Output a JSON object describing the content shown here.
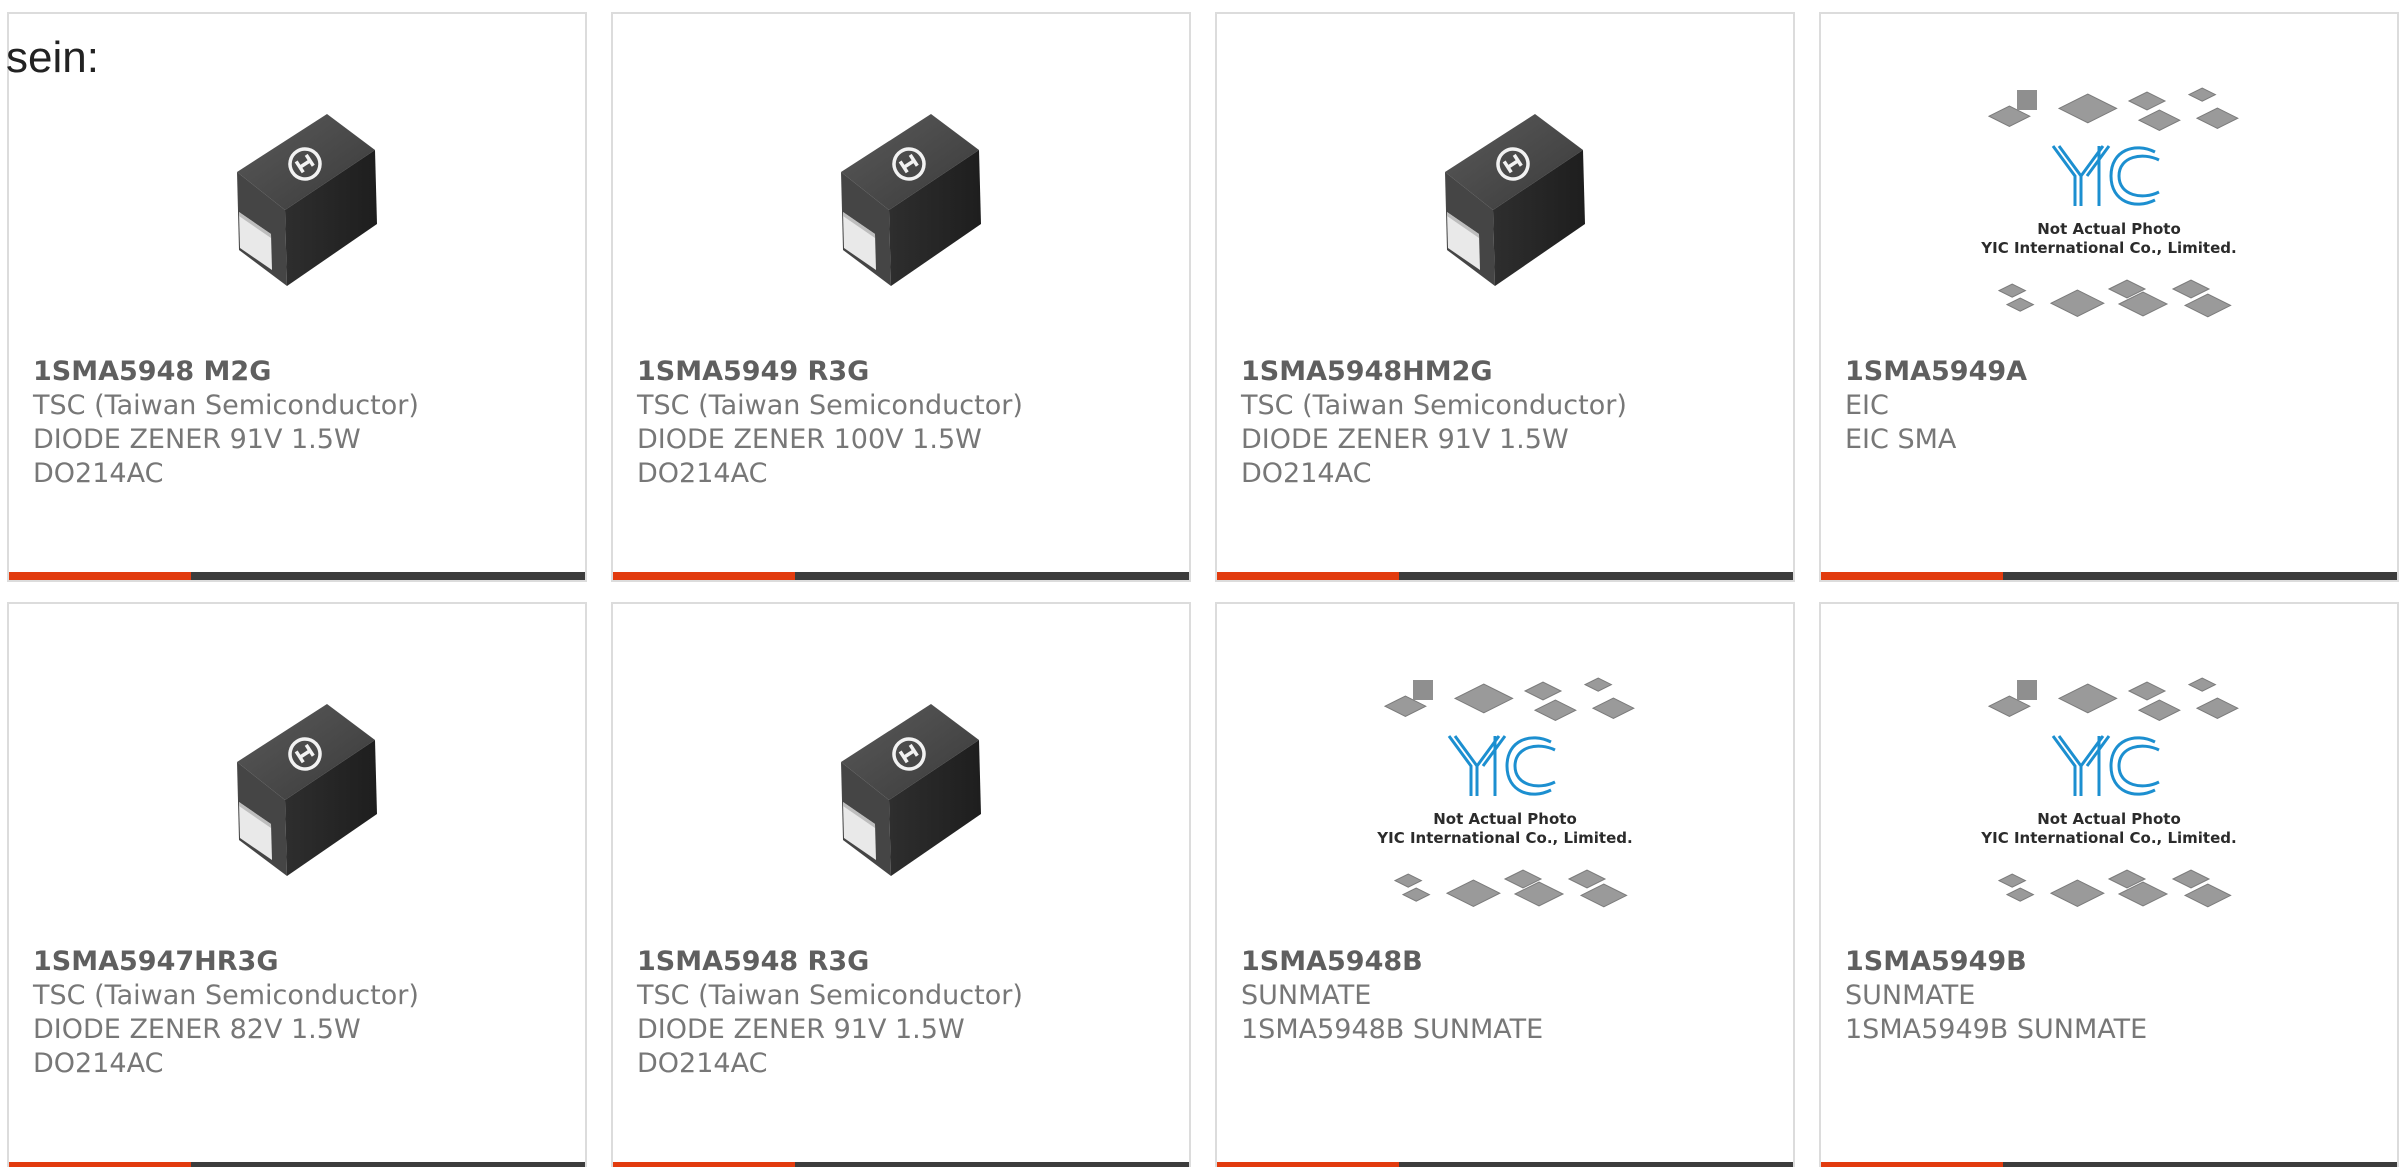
{
  "intro_text": "sein:",
  "colors": {
    "accent": "#e23b0e",
    "bar": "#3c3c3c",
    "card_border": "#dcdcdc",
    "text": "#777777",
    "yic_blue": "#1c8fd0"
  },
  "placeholder": {
    "line1": "Not Actual Photo",
    "line2": "YIC International Co., Limited."
  },
  "products": [
    {
      "part": "1SMA5948 M2G",
      "manufacturer": "TSC (Taiwan Semiconductor)",
      "description": "DIODE ZENER 91V 1.5W",
      "package": "DO214AC",
      "image": "sma-diode-icon"
    },
    {
      "part": "1SMA5949 R3G",
      "manufacturer": "TSC (Taiwan Semiconductor)",
      "description": "DIODE ZENER 100V 1.5W",
      "package": "DO214AC",
      "image": "sma-diode-icon"
    },
    {
      "part": "1SMA5948HM2G",
      "manufacturer": "TSC (Taiwan Semiconductor)",
      "description": "DIODE ZENER 91V 1.5W",
      "package": "DO214AC",
      "image": "sma-diode-icon"
    },
    {
      "part": "1SMA5949A",
      "manufacturer": "EIC",
      "description": "EIC SMA",
      "package": "",
      "image": "yic-placeholder"
    },
    {
      "part": "1SMA5947HR3G",
      "manufacturer": "TSC (Taiwan Semiconductor)",
      "description": "DIODE ZENER 82V 1.5W",
      "package": "DO214AC",
      "image": "sma-diode-icon"
    },
    {
      "part": "1SMA5948 R3G",
      "manufacturer": "TSC (Taiwan Semiconductor)",
      "description": "DIODE ZENER 91V 1.5W",
      "package": "DO214AC",
      "image": "sma-diode-icon"
    },
    {
      "part": "1SMA5948B",
      "manufacturer": "SUNMATE",
      "description": "1SMA5948B SUNMATE",
      "package": "",
      "image": "yic-placeholder"
    },
    {
      "part": "1SMA5949B",
      "manufacturer": "SUNMATE",
      "description": "1SMA5949B SUNMATE",
      "package": "",
      "image": "yic-placeholder"
    }
  ]
}
